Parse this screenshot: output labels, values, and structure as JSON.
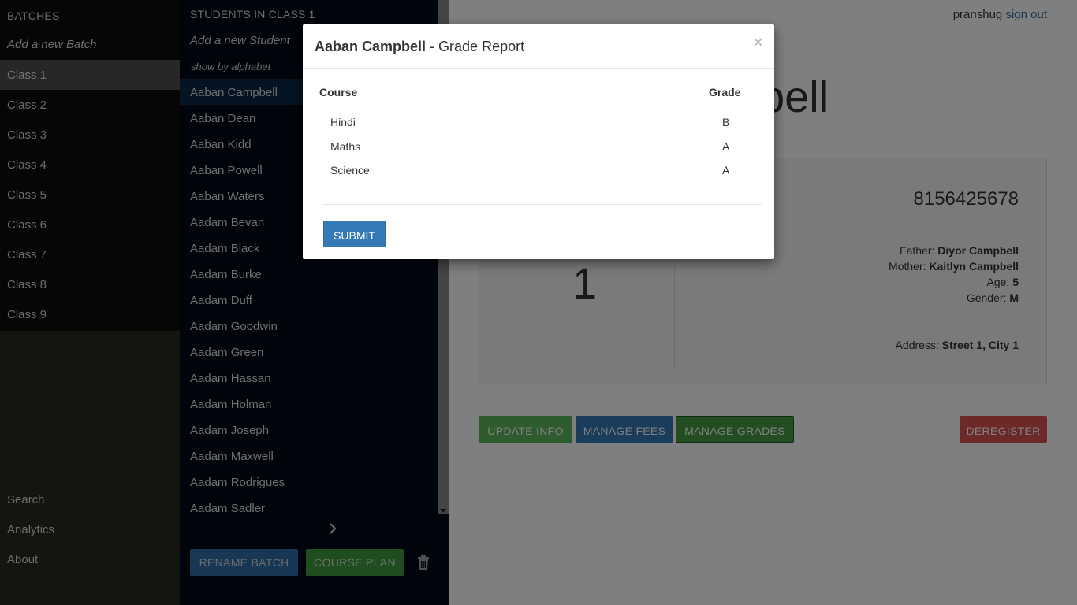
{
  "sidebar": {
    "heading": "BATCHES",
    "add_label": "Add a new Batch",
    "classes": [
      "Class 1",
      "Class 2",
      "Class 3",
      "Class 4",
      "Class 5",
      "Class 6",
      "Class 7",
      "Class 8",
      "Class 9"
    ],
    "active_class": "Class 1",
    "bottom": [
      "Search",
      "Analytics",
      "About"
    ]
  },
  "students": {
    "heading": "STUDENTS IN CLASS 1",
    "add_label": "Add a new Student",
    "alpha_label": "show by alphabet",
    "items": [
      "Aaban Campbell",
      "Aaban Dean",
      "Aaban Kidd",
      "Aaban Powell",
      "Aaban Waters",
      "Aadam Bevan",
      "Aadam Black",
      "Aadam Burke",
      "Aadam Duff",
      "Aadam Goodwin",
      "Aadam Green",
      "Aadam Hassan",
      "Aadam Holman",
      "Aadam Joseph",
      "Aadam Maxwell",
      "Aadam Rodrigues",
      "Aadam Sadler"
    ],
    "active": "Aaban Campbell",
    "rename_label": "RENAME BATCH",
    "course_label": "COURSE PLAN"
  },
  "user": {
    "name": "pranshug",
    "signout": "sign out"
  },
  "profile": {
    "title_visible": "bell",
    "class_number": "1",
    "phone": "8156425678",
    "father_label": "Father:",
    "father": "Diyor Campbell",
    "mother_label": "Mother:",
    "mother": "Kaitlyn Campbell",
    "age_label": "Age:",
    "age": "5",
    "gender_label": "Gender:",
    "gender": "M",
    "address_label": "Address:",
    "address": "Street 1, City 1"
  },
  "actions": {
    "update": "UPDATE INFO",
    "fees": "MANAGE FEES",
    "grades": "MANAGE GRADES",
    "deregister": "DEREGISTER"
  },
  "modal": {
    "student": "Aaban Campbell",
    "title_suffix": "- Grade Report",
    "close": "×",
    "col_course": "Course",
    "col_grade": "Grade",
    "rows": [
      {
        "course": "Hindi",
        "grade": "B"
      },
      {
        "course": "Maths",
        "grade": "A"
      },
      {
        "course": "Science",
        "grade": "A"
      }
    ],
    "submit": "SUBMIT"
  },
  "colors": {
    "sidebar_dark": "#0d0d0d",
    "students_bg": "#010a19",
    "primary": "#337ab7",
    "success": "#5cb85c",
    "danger": "#d9534f"
  }
}
